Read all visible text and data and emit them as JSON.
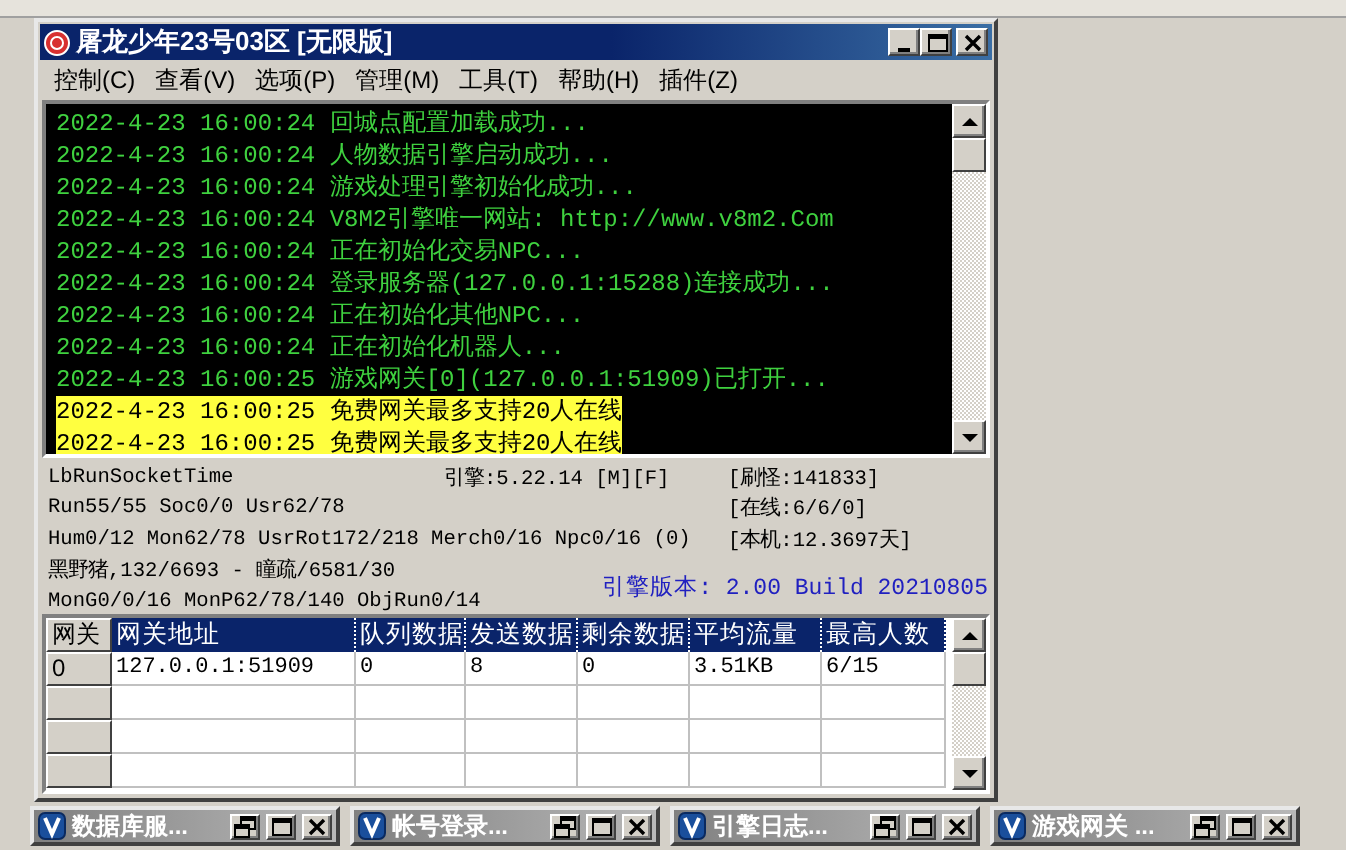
{
  "window": {
    "title": "屠龙少年23号03区 [无限版]"
  },
  "menu": [
    {
      "label": "控制(C)"
    },
    {
      "label": "查看(V)"
    },
    {
      "label": "选项(P)"
    },
    {
      "label": "管理(M)"
    },
    {
      "label": "工具(T)"
    },
    {
      "label": "帮助(H)"
    },
    {
      "label": "插件(Z)"
    }
  ],
  "log": [
    {
      "text": "2022-4-23 16:00:24 回城点配置加载成功...",
      "highlighted": false
    },
    {
      "text": "2022-4-23 16:00:24 人物数据引擎启动成功...",
      "highlighted": false
    },
    {
      "text": "2022-4-23 16:00:24 游戏处理引擎初始化成功...",
      "highlighted": false
    },
    {
      "text": "2022-4-23 16:00:24 V8M2引擎唯一网站: http://www.v8m2.Com",
      "highlighted": false
    },
    {
      "text": "2022-4-23 16:00:24 正在初始化交易NPC...",
      "highlighted": false
    },
    {
      "text": "2022-4-23 16:00:24 登录服务器(127.0.0.1:15288)连接成功...",
      "highlighted": false
    },
    {
      "text": "2022-4-23 16:00:24 正在初始化其他NPC...",
      "highlighted": false
    },
    {
      "text": "2022-4-23 16:00:24 正在初始化机器人...",
      "highlighted": false
    },
    {
      "text": "2022-4-23 16:00:25 游戏网关[0](127.0.0.1:51909)已打开...",
      "highlighted": false
    },
    {
      "text": "2022-4-23 16:00:25 免费网关最多支持20人在线",
      "highlighted": true
    },
    {
      "text": "2022-4-23 16:00:25 免费网关最多支持20人在线",
      "highlighted": true
    }
  ],
  "stats": {
    "socket_time": "LbRunSocketTime",
    "engine": "引擎:5.22.14 [M][F]",
    "spawn": "[刷怪:141833]",
    "run": "Run55/55 Soc0/0 Usr62/78",
    "online": "[在线:6/6/0]",
    "hum": "Hum0/12 Mon62/78 UsrRot172/218 Merch0/16 Npc0/16 (0)",
    "local": "[本机:12.3697天]",
    "monster": "黑野猪,132/6693 - 瞳疏/6581/30",
    "mong": "MonG0/0/16 MonP62/78/140 ObjRun0/14",
    "version": "引擎版本: 2.00 Build 20210805"
  },
  "table": {
    "columns": [
      "网关",
      "网关地址",
      "队列数据",
      "发送数据",
      "剩余数据",
      "平均流量",
      "最高人数"
    ],
    "rows": [
      [
        "0",
        "127.0.0.1:51909",
        "0",
        "8",
        "0",
        "3.51KB",
        "6/15"
      ]
    ]
  },
  "minimized_windows": [
    {
      "title": "数据库服..."
    },
    {
      "title": "帐号登录..."
    },
    {
      "title": "引擎日志..."
    },
    {
      "title": "游戏网关 ..."
    }
  ]
}
